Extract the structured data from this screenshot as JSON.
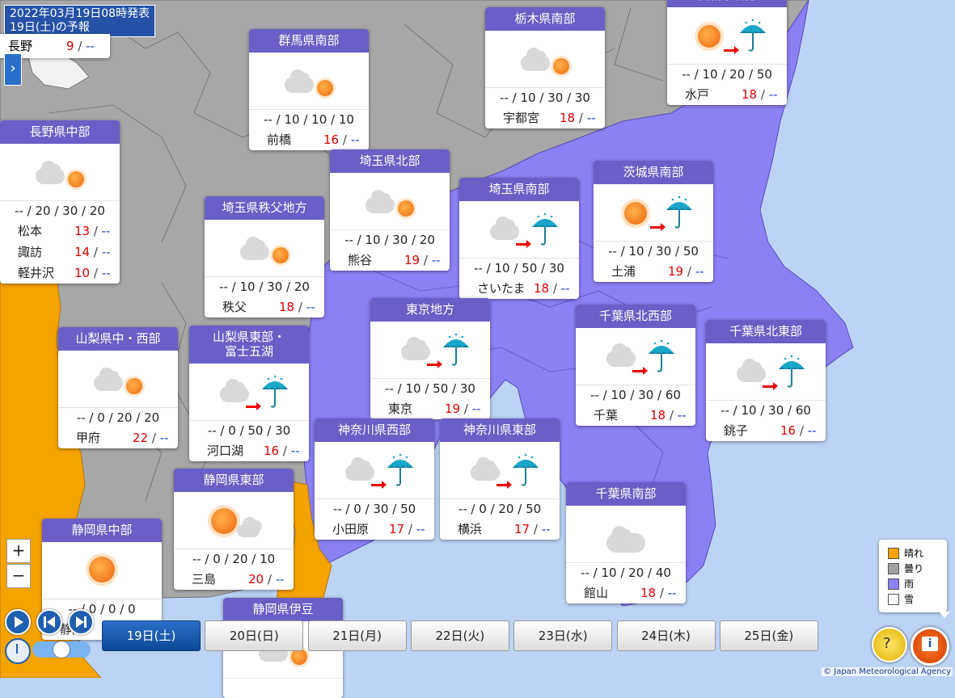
{
  "header": {
    "line1": "2022年03月19日08時発表",
    "line2": "19日(土)の予報"
  },
  "partial_card": {
    "name": "長野",
    "max": "9",
    "min": "--"
  },
  "cards": [
    {
      "title": "群馬県南部",
      "pop": "-- / 10 / 10 / 10",
      "rows": [
        {
          "name": "前橋",
          "max": "16",
          "min": "--"
        }
      ]
    },
    {
      "title": "栃木県南部",
      "pop": "-- / 10 / 30 / 30",
      "rows": [
        {
          "name": "宇都宮",
          "max": "18",
          "min": "--"
        }
      ]
    },
    {
      "title": "茨城県北部",
      "pop": "-- / 10 / 20 / 50",
      "rows": [
        {
          "name": "水戸",
          "max": "18",
          "min": "--"
        }
      ]
    },
    {
      "title": "長野県中部",
      "pop": "-- / 20 / 30 / 20",
      "rows": [
        {
          "name": "松本",
          "max": "13",
          "min": "--"
        },
        {
          "name": "諏訪",
          "max": "14",
          "min": "--"
        },
        {
          "name": "軽井沢",
          "max": "10",
          "min": "--"
        }
      ]
    },
    {
      "title": "埼玉県北部",
      "pop": "-- / 10 / 30 / 20",
      "rows": [
        {
          "name": "熊谷",
          "max": "19",
          "min": "--"
        }
      ]
    },
    {
      "title": "埼玉県南部",
      "pop": "-- / 10 / 50 / 30",
      "rows": [
        {
          "name": "さいたま",
          "max": "18",
          "min": "--"
        }
      ]
    },
    {
      "title": "茨城県南部",
      "pop": "-- / 10 / 30 / 50",
      "rows": [
        {
          "name": "土浦",
          "max": "19",
          "min": "--"
        }
      ]
    },
    {
      "title": "埼玉県秩父地方",
      "pop": "-- / 10 / 30 / 20",
      "rows": [
        {
          "name": "秩父",
          "max": "18",
          "min": "--"
        }
      ]
    },
    {
      "title": "東京地方",
      "pop": "-- / 10 / 50 / 30",
      "rows": [
        {
          "name": "東京",
          "max": "19",
          "min": "--"
        }
      ]
    },
    {
      "title": "千葉県北西部",
      "pop": "-- / 10 / 30 / 60",
      "rows": [
        {
          "name": "千葉",
          "max": "18",
          "min": "--"
        }
      ]
    },
    {
      "title": "千葉県北東部",
      "pop": "-- / 10 / 30 / 60",
      "rows": [
        {
          "name": "銚子",
          "max": "16",
          "min": "--"
        }
      ]
    },
    {
      "title": "山梨県中・西部",
      "pop": "-- / 0 / 20 / 20",
      "rows": [
        {
          "name": "甲府",
          "max": "22",
          "min": "--"
        }
      ]
    },
    {
      "title": "山梨県東部・\n富士五湖",
      "pop": "-- / 0 / 50 / 30",
      "rows": [
        {
          "name": "河口湖",
          "max": "16",
          "min": "--"
        }
      ]
    },
    {
      "title": "神奈川県西部",
      "pop": "-- / 0 / 30 / 50",
      "rows": [
        {
          "name": "小田原",
          "max": "17",
          "min": "--"
        }
      ]
    },
    {
      "title": "神奈川県東部",
      "pop": "-- / 0 / 20 / 50",
      "rows": [
        {
          "name": "横浜",
          "max": "17",
          "min": "--"
        }
      ]
    },
    {
      "title": "静岡県東部",
      "pop": "-- / 0 / 20 / 10",
      "rows": [
        {
          "name": "三島",
          "max": "20",
          "min": "--"
        }
      ]
    },
    {
      "title": "千葉県南部",
      "pop": "-- / 10 / 20 / 40",
      "rows": [
        {
          "name": "館山",
          "max": "18",
          "min": "--"
        }
      ]
    },
    {
      "title": "静岡県中部",
      "pop": "-- / 0 / 0 / 0",
      "rows": [
        {
          "name": "静岡",
          "max": "",
          "min": ""
        }
      ]
    },
    {
      "title": "静岡県伊豆",
      "pop": "",
      "rows": []
    }
  ],
  "day_tabs": [
    "19日(土)",
    "20日(日)",
    "21日(月)",
    "22日(火)",
    "23日(水)",
    "24日(木)",
    "25日(金)"
  ],
  "legend": [
    {
      "label": "晴れ",
      "color": "#f5a300"
    },
    {
      "label": "曇り",
      "color": "#a0a0a0"
    },
    {
      "label": "雨",
      "color": "#8c80f5"
    },
    {
      "label": "雪",
      "color": "#ffffff"
    }
  ],
  "zoom": {
    "in": "+",
    "out": "−"
  },
  "credit": "© Japan Meteorological Agency",
  "colors": {
    "sunny": "#f5a300",
    "cloudy": "#a7a7a7",
    "rain": "#8c80f5",
    "sea": "#bcd3f5",
    "card_header": "#6a5fc6"
  }
}
